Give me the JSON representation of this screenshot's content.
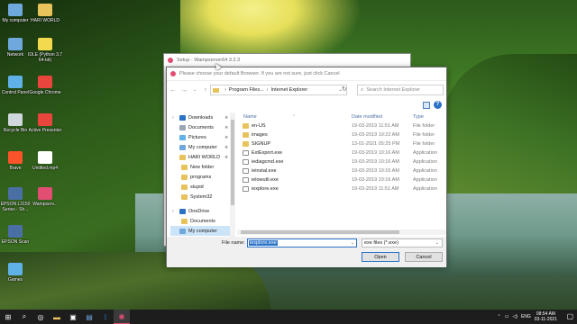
{
  "desktop_icons": [
    {
      "label": "My computer",
      "icon": "computer-icon",
      "color": "#6fa8dc"
    },
    {
      "label": "HARI WORLD",
      "icon": "folder-icon",
      "color": "#e8c25a"
    },
    {
      "label": "Network",
      "icon": "network-icon",
      "color": "#6fa8dc"
    },
    {
      "label": "IDLE (Python 3.7 64-bit)",
      "icon": "python-icon",
      "color": "#f2d94e"
    },
    {
      "label": "Control Panel",
      "icon": "control-panel-icon",
      "color": "#5fb1e8"
    },
    {
      "label": "Google Chrome",
      "icon": "chrome-icon",
      "color": "#e8453c"
    },
    {
      "label": "Recycle Bin",
      "icon": "recycle-bin-icon",
      "color": "#cfd6dc"
    },
    {
      "label": "Active Presenter",
      "icon": "active-presenter-icon",
      "color": "#e8453c"
    },
    {
      "label": "Brave",
      "icon": "brave-icon",
      "color": "#fb542b"
    },
    {
      "label": "Untitled.mp4",
      "icon": "video-file-icon",
      "color": "#ffffff"
    },
    {
      "label": "EPSON L3150 Series - Sh...",
      "icon": "printer-icon",
      "color": "#4a6fa5"
    },
    {
      "label": "Wampserv...",
      "icon": "wampserver-icon",
      "color": "#e14d73"
    },
    {
      "label": "EPSON Scan",
      "icon": "scanner-icon",
      "color": "#4a6fa5"
    },
    {
      "label": "Games",
      "icon": "games-icon",
      "color": "#5fb1e8"
    }
  ],
  "setup_window": {
    "title": "Setup - Wampserver64 3.2.3"
  },
  "dialog": {
    "title": "Please choose your default Browser. If you are not sure, just click Cancel",
    "address": [
      "Program Files...",
      "Internet Explorer"
    ],
    "search_placeholder": "Search Internet Explorer",
    "nav_items": [
      {
        "label": "Downloads",
        "icon": "downloads-icon",
        "color": "#2a72c7",
        "pinned": true
      },
      {
        "label": "Documents",
        "icon": "documents-icon",
        "color": "#9aa7b5",
        "pinned": true
      },
      {
        "label": "Pictures",
        "icon": "pictures-icon",
        "color": "#5fb1e8",
        "pinned": true
      },
      {
        "label": "My computer",
        "icon": "computer-icon",
        "color": "#6fa8dc",
        "pinned": true
      },
      {
        "label": "HARI WORLD",
        "icon": "folder-icon",
        "color": "#e8c25a",
        "pinned": true
      },
      {
        "label": "New folder",
        "icon": "folder-icon",
        "color": "#e8c25a",
        "pinned": false
      },
      {
        "label": "programs",
        "icon": "folder-icon",
        "color": "#e8c25a",
        "pinned": false
      },
      {
        "label": "stupid",
        "icon": "folder-icon",
        "color": "#e8c25a",
        "pinned": false
      },
      {
        "label": "System32",
        "icon": "folder-icon",
        "color": "#e8c25a",
        "pinned": false
      },
      {
        "label": "OneDrive",
        "icon": "onedrive-icon",
        "color": "#2a72c7",
        "pinned": false
      },
      {
        "label": "Documents",
        "icon": "folder-icon",
        "color": "#e8c25a",
        "pinned": false
      },
      {
        "label": "My computer",
        "icon": "computer-icon",
        "color": "#6fa8dc",
        "pinned": false
      }
    ],
    "columns": {
      "name": "Name",
      "date": "Date modified",
      "type": "Type"
    },
    "files": [
      {
        "name": "en-US",
        "date": "19-03-2019 11:51 AM",
        "type": "File folder",
        "kind": "folder"
      },
      {
        "name": "images",
        "date": "19-03-2019 10:22 AM",
        "type": "File folder",
        "kind": "folder"
      },
      {
        "name": "SIGNUP",
        "date": "13-01-2021 05:25 PM",
        "type": "File folder",
        "kind": "folder"
      },
      {
        "name": "ExtExport.exe",
        "date": "19-03-2019 10:16 AM",
        "type": "Application",
        "kind": "app"
      },
      {
        "name": "iediagcmd.exe",
        "date": "19-03-2019 10:16 AM",
        "type": "Application",
        "kind": "app"
      },
      {
        "name": "ieinstal.exe",
        "date": "19-03-2019 10:16 AM",
        "type": "Application",
        "kind": "app"
      },
      {
        "name": "ielowutil.exe",
        "date": "19-03-2019 10:16 AM",
        "type": "Application",
        "kind": "app"
      },
      {
        "name": "iexplore.exe",
        "date": "19-03-2019 11:51 AM",
        "type": "Application",
        "kind": "app"
      }
    ],
    "file_name_label": "File name:",
    "file_name_value": "iexplore.exe",
    "file_type_value": "exe files (*.exe)",
    "open_label": "Open",
    "cancel_label": "Cancel"
  },
  "taskbar": {
    "icons": [
      "start-icon",
      "search-icon",
      "task-view-icon",
      "file-explorer-icon",
      "store-icon",
      "app-icon",
      "bluetooth-icon",
      "wampserver-icon"
    ],
    "language": "ENG",
    "time": "08:54 AM",
    "date": "03-11-2021"
  }
}
